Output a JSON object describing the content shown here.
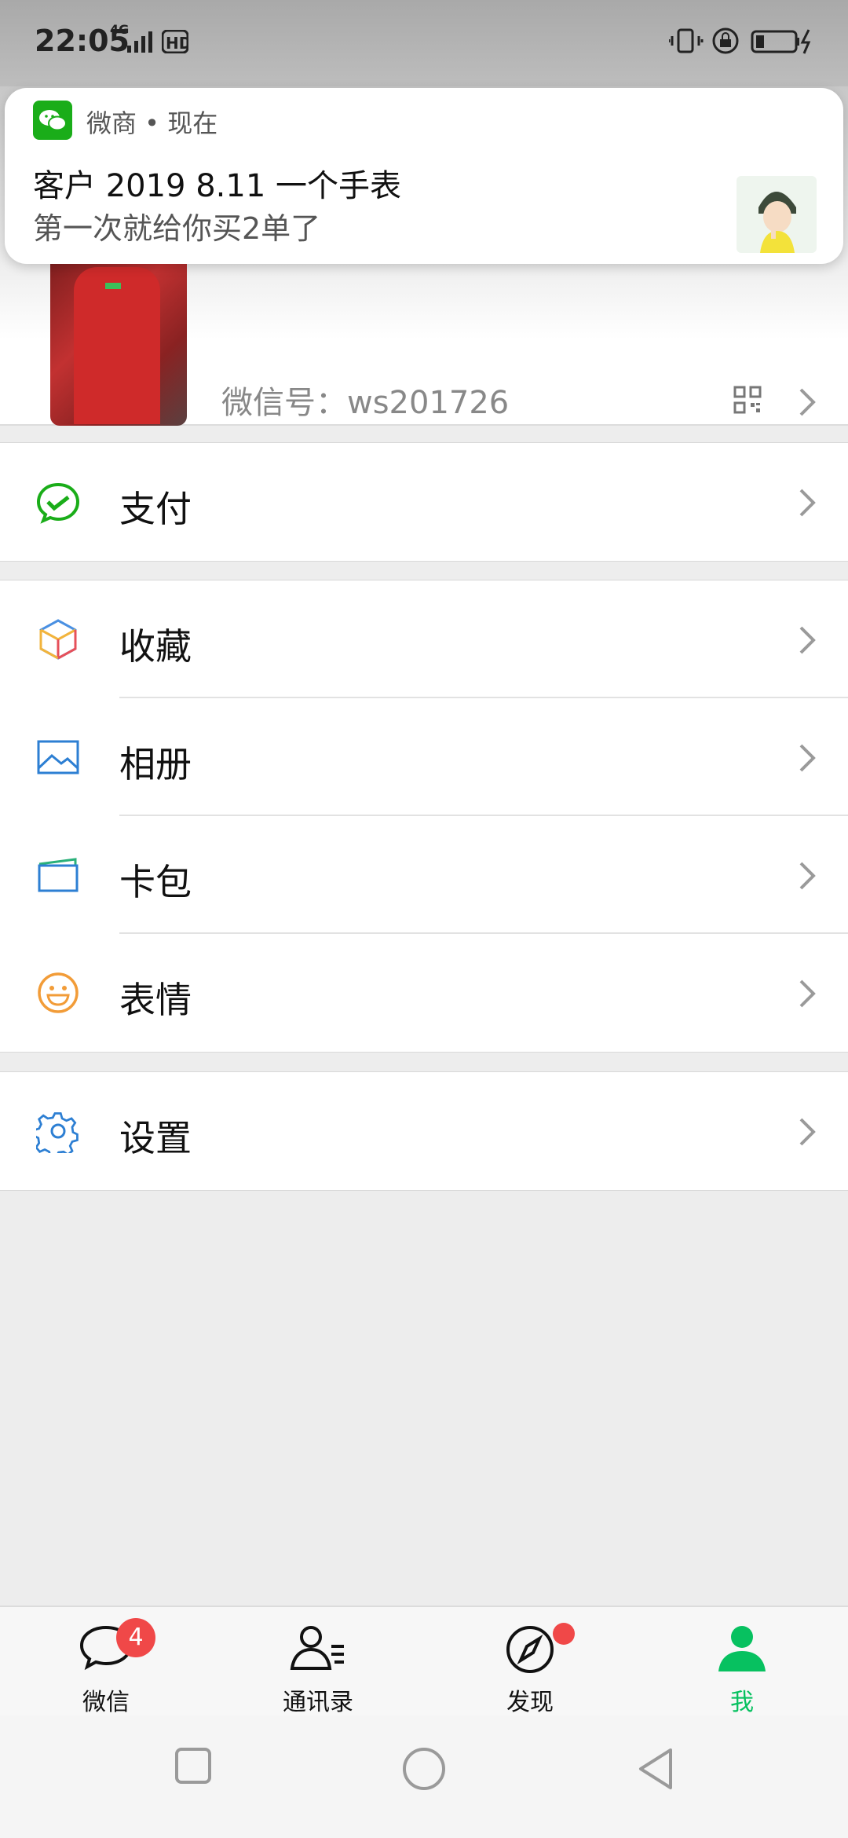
{
  "status_bar": {
    "time": "22:05",
    "network": "4G"
  },
  "notification": {
    "app_name": "微商 • 现在",
    "title": "客户 2019 8.11 一个手表",
    "text": "第一次就给你买2单了"
  },
  "profile": {
    "wechat_id": "微信号：ws201726"
  },
  "menu": {
    "pay": "支付",
    "favorites": "收藏",
    "album": "相册",
    "cards": "卡包",
    "stickers": "表情",
    "settings": "设置"
  },
  "tabs": {
    "chats": "微信",
    "chats_badge": "4",
    "contacts": "通讯录",
    "discover": "发现",
    "me": "我"
  },
  "colors": {
    "accent": "#07c160",
    "badge": "#f04848"
  }
}
